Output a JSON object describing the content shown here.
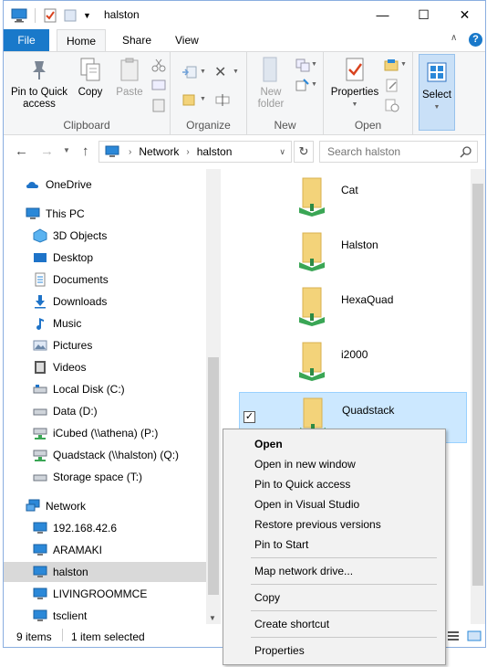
{
  "window": {
    "title": "halston",
    "minimize_glyph": "—",
    "maximize_glyph": "☐",
    "close_glyph": "✕"
  },
  "ribbon_tabs": {
    "file": "File",
    "home": "Home",
    "share": "Share",
    "view": "View"
  },
  "ribbon": {
    "pin_to_quick_access_line1": "Pin to Quick",
    "pin_to_quick_access_line2": "access",
    "copy": "Copy",
    "paste": "Paste",
    "new_folder_line1": "New",
    "new_folder_line2": "folder",
    "properties": "Properties",
    "select": "Select",
    "groups": {
      "clipboard": "Clipboard",
      "organize": "Organize",
      "new": "New",
      "open": "Open"
    }
  },
  "address": {
    "segments": [
      "Network",
      "halston"
    ],
    "search_placeholder": "Search halston"
  },
  "nav": {
    "onedrive": "OneDrive",
    "this_pc": "This PC",
    "pc_items": [
      "3D Objects",
      "Desktop",
      "Documents",
      "Downloads",
      "Music",
      "Pictures",
      "Videos",
      "Local Disk (C:)",
      "Data (D:)",
      "iCubed (\\\\athena) (P:)",
      "Quadstack (\\\\halston) (Q:)",
      "Storage space (T:)"
    ],
    "network": "Network",
    "network_items": [
      "192.168.42.6",
      "ARAMAKI",
      "halston",
      "LIVINGROOMMCE",
      "tsclient"
    ]
  },
  "content": {
    "folders": [
      "Cat",
      "Halston",
      "HexaQuad",
      "i2000",
      "Quadstack"
    ],
    "checkmark": "✓"
  },
  "status": {
    "items": "9 items",
    "selected": "1 item selected"
  },
  "context_menu": {
    "open": "Open",
    "open_new_window": "Open in new window",
    "pin_quick_access": "Pin to Quick access",
    "open_visual_studio": "Open in Visual Studio",
    "restore_previous": "Restore previous versions",
    "pin_start": "Pin to Start",
    "map_network_drive": "Map network drive...",
    "copy": "Copy",
    "create_shortcut": "Create shortcut",
    "properties": "Properties"
  },
  "colors": {
    "accent": "#1979ca",
    "selection": "#cce8ff",
    "folder": "#f3d37a",
    "network_pipe": "#3aa655"
  }
}
